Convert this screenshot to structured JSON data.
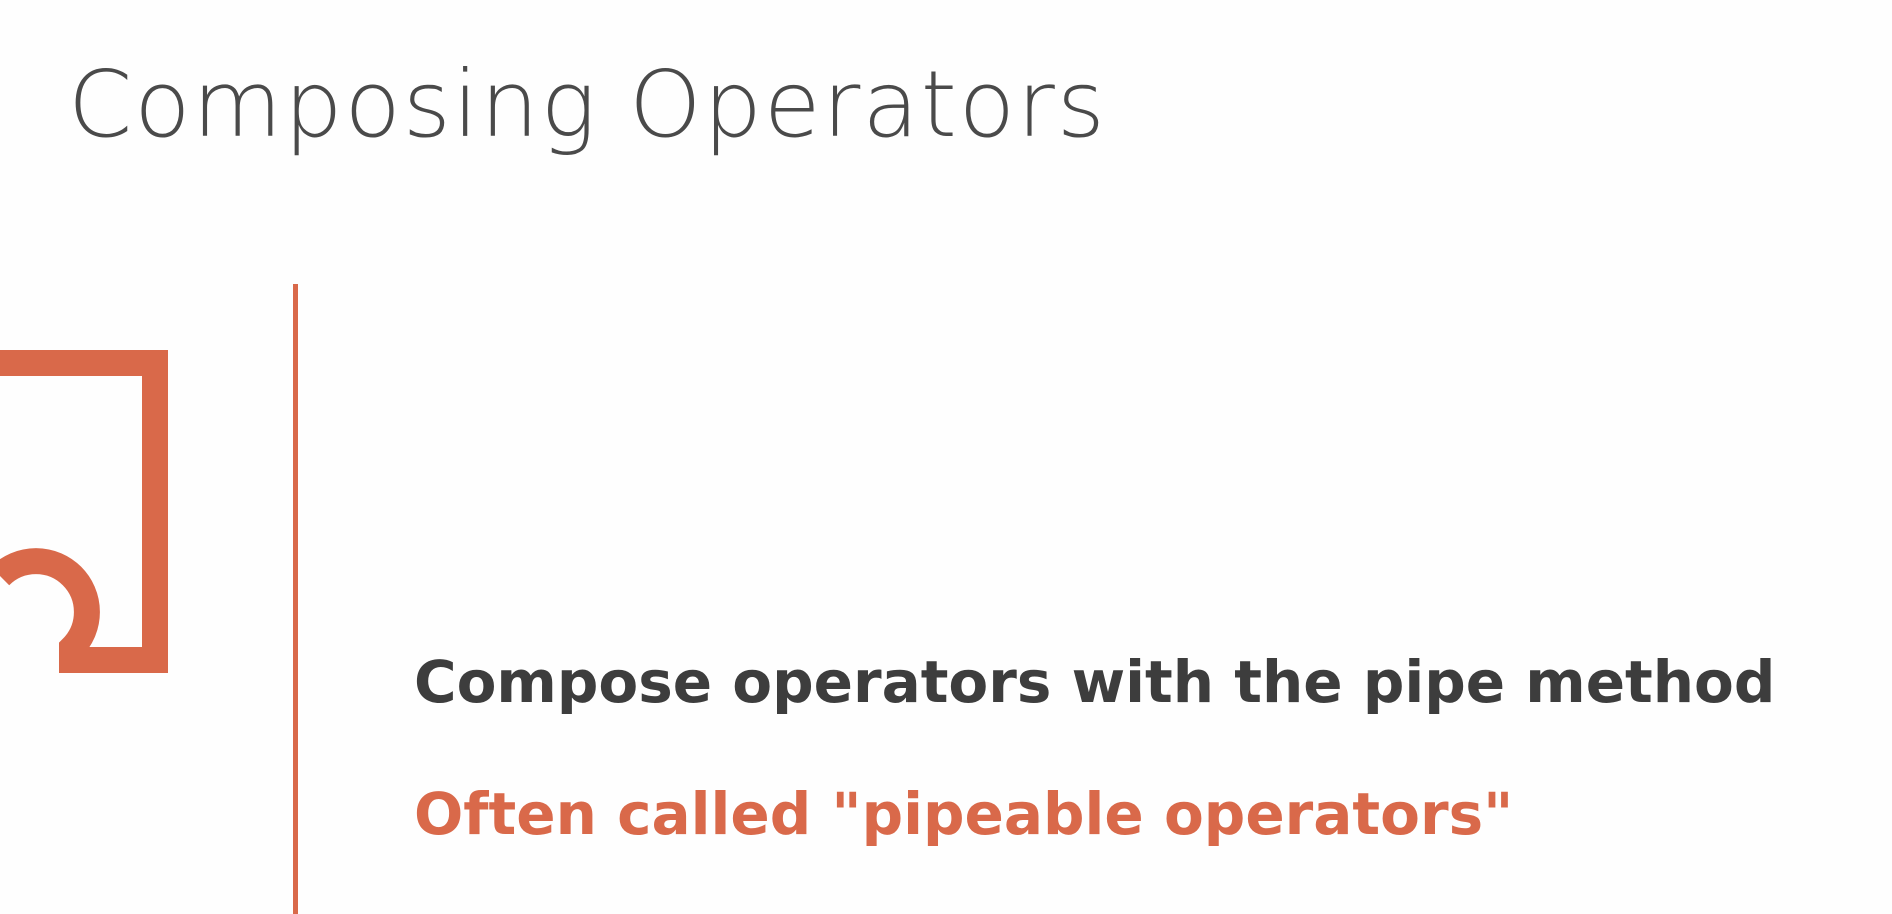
{
  "slide": {
    "title": "Composing Operators",
    "bullets": [
      "Compose operators with the pipe method",
      "Often called \"pipeable operators\""
    ],
    "icon": "puzzle-piece-icon",
    "colors": {
      "accent": "#d9694a",
      "title_text": "#4a4a4a",
      "body_text": "#3d3d3d",
      "background": "#fefefe"
    }
  }
}
